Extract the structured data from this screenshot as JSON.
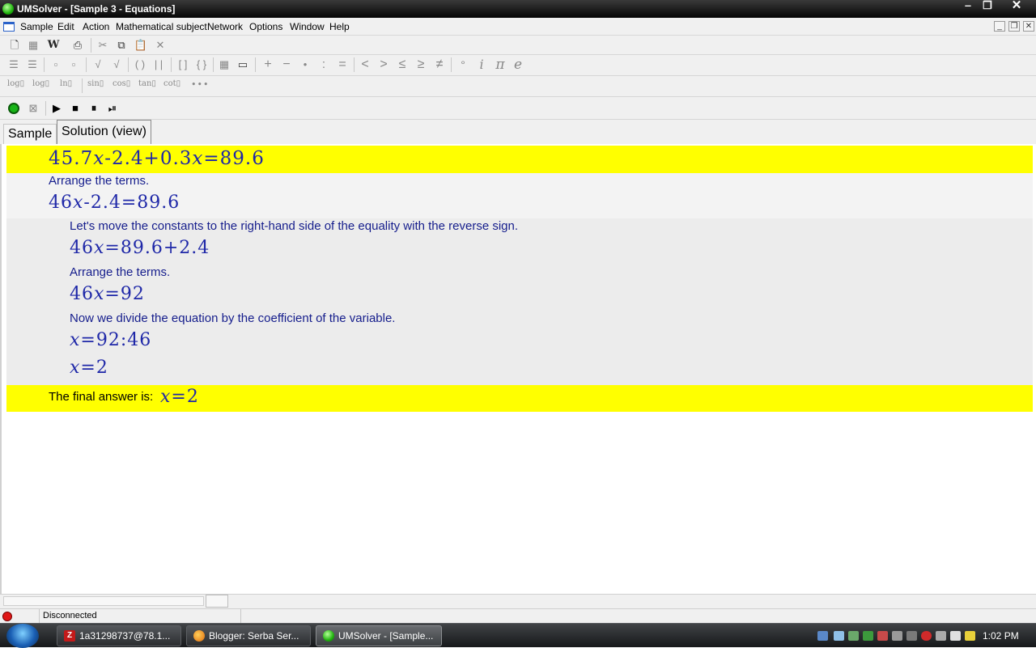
{
  "window": {
    "title": "UMSolver - [Sample 3 - Equations]"
  },
  "menu": [
    "Sample",
    "Edit",
    "Action",
    "Mathematical subject",
    "Network",
    "Options",
    "Window",
    "Help"
  ],
  "toolbar_functions": [
    "log",
    "log",
    "ln",
    "sin",
    "cos",
    "tan",
    "cot"
  ],
  "toolbar_symbols": {
    "plus": "+",
    "minus": "−",
    "dot": "•",
    "colon": ":",
    "equals": "=",
    "lt": "<",
    "gt": ">",
    "le": "≤",
    "ge": "≥",
    "ne": "≠",
    "degree": "°",
    "i": "i",
    "pi": "π",
    "e": "e",
    "word": "W",
    "more": "•••"
  },
  "tabs": {
    "sample": "Sample",
    "solution": "Solution (view)"
  },
  "solution": {
    "problem": {
      "a": "45.7",
      "b": "-2.4+0.3",
      "c": "=89.6"
    },
    "step1_text": "Arrange the terms.",
    "step1_eq": {
      "a": "46",
      "b": "-2.4=89.6"
    },
    "step2_text": "Let's move the constants to the right-hand side of the equality with the reverse sign.",
    "step2_eq": {
      "a": "46",
      "b": "=89.6+2.4"
    },
    "step3_text": "Arrange the terms.",
    "step3_eq": {
      "a": "46",
      "b": "=92"
    },
    "step4_text": "Now we divide the equation by the coefficient of the variable.",
    "step4_eq": {
      "b": "=92:46"
    },
    "step5_eq": {
      "b": "=2"
    },
    "final_text": "The final answer is:",
    "final_eq": {
      "b": "=2"
    },
    "variable": "x"
  },
  "status": {
    "connection": "Disconnected"
  },
  "taskbar": {
    "tasks": [
      "1a31298737@78.1...",
      "Blogger: Serba Ser...",
      "UMSolver - [Sample..."
    ],
    "clock": "1:02 PM"
  },
  "colors": {
    "highlight": "#ffff00",
    "step_bg": "#f0f0f0",
    "math": "#1f28a8"
  }
}
